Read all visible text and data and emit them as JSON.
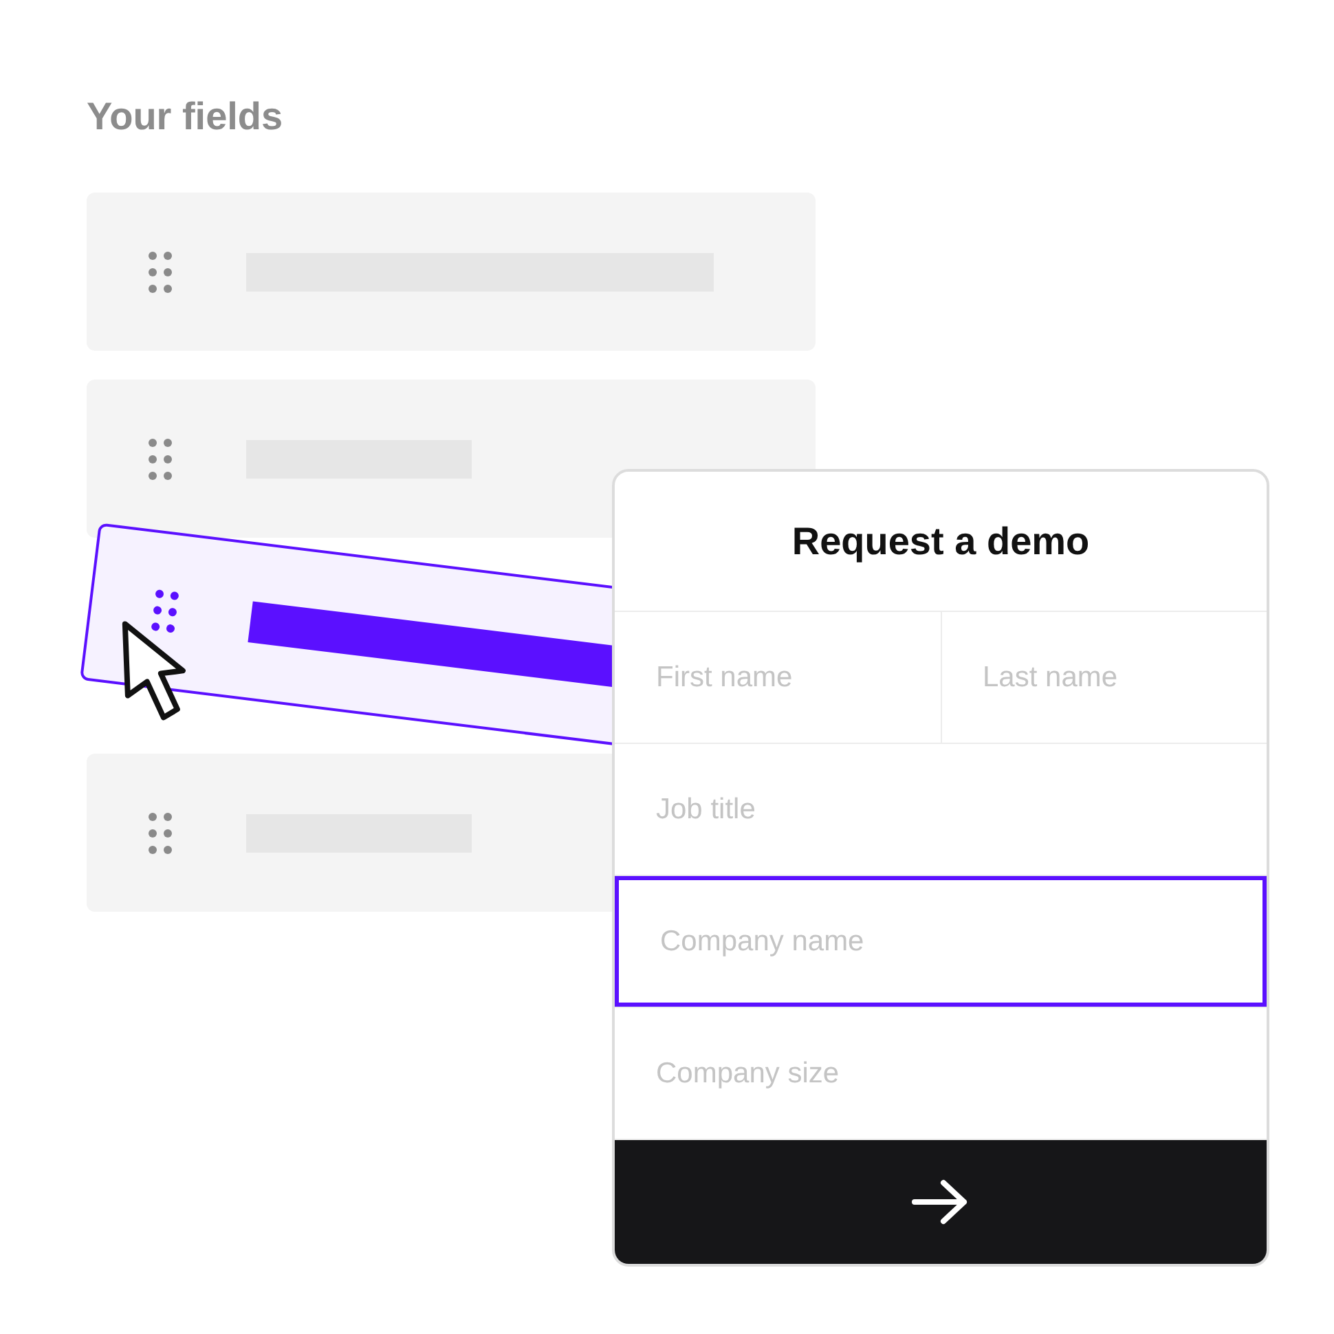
{
  "heading": "Your fields",
  "field_cards": [
    {
      "kind": "long",
      "dragging": false
    },
    {
      "kind": "short",
      "dragging": false
    },
    {
      "kind": "long",
      "dragging": true
    },
    {
      "kind": "short",
      "dragging": false
    }
  ],
  "form": {
    "title": "Request a demo",
    "rows": [
      [
        {
          "placeholder": "First name",
          "selected": false
        },
        {
          "placeholder": "Last name",
          "selected": false
        }
      ],
      [
        {
          "placeholder": "Job title",
          "selected": false
        }
      ],
      [
        {
          "placeholder": "Company name",
          "selected": true
        }
      ],
      [
        {
          "placeholder": "Company size",
          "selected": false
        }
      ]
    ]
  }
}
